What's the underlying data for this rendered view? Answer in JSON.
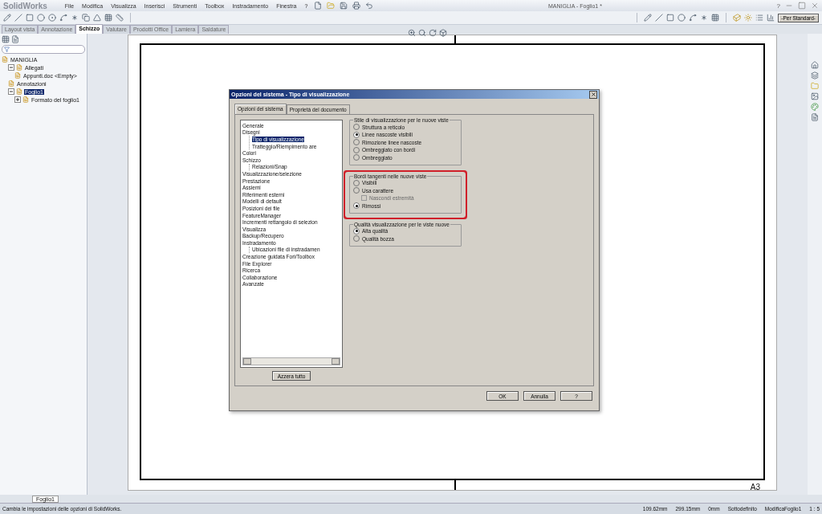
{
  "app": {
    "logo": "SolidWorks",
    "menus": [
      "File",
      "Modifica",
      "Visualizza",
      "Inserisci",
      "Strumenti",
      "Toolbox",
      "Instradamento",
      "Finestra",
      "?"
    ],
    "title": "MANIGLIA - Foglio1 *",
    "help": "?"
  },
  "command_tabs": [
    {
      "label": "Layout vista",
      "selected": false
    },
    {
      "label": "Annotazione",
      "selected": false
    },
    {
      "label": "Schizzo",
      "selected": true
    },
    {
      "label": "Valutare",
      "selected": false
    },
    {
      "label": "Prodotti Office",
      "selected": false
    },
    {
      "label": "Lamiera",
      "selected": false
    },
    {
      "label": "Saldature",
      "selected": false
    }
  ],
  "style_dropdown": {
    "value": "-Per Standard-"
  },
  "tree": {
    "items": [
      {
        "label": "MANIGLIA",
        "selected": false,
        "children": [
          {
            "label": "Allegati",
            "selected": false,
            "expanded": true,
            "children": [
              {
                "label": "Appunti.doc <Empty>",
                "selected": false
              }
            ]
          },
          {
            "label": "Annotazioni",
            "selected": false
          },
          {
            "label": "Foglio1",
            "selected": true,
            "expanded": true,
            "children": [
              {
                "label": "Formato del foglio1",
                "selected": false,
                "expanded": false
              }
            ]
          }
        ]
      }
    ]
  },
  "sheet": {
    "label": "A3"
  },
  "dialog": {
    "title": "Opzioni del sistema - Tipo di visualizzazione",
    "tabs": [
      {
        "label": "Opzioni del sistema",
        "selected": true
      },
      {
        "label": "Proprietà del documento",
        "selected": false
      }
    ],
    "options_tree": [
      {
        "label": "Generale",
        "selected": false
      },
      {
        "label": "Disegni",
        "selected": false,
        "children": [
          {
            "label": "Tipo di visualizzazione",
            "selected": true
          },
          {
            "label": "Tratteggio/Riempimento are",
            "selected": false
          }
        ]
      },
      {
        "label": "Colori",
        "selected": false
      },
      {
        "label": "Schizzo",
        "selected": false,
        "children": [
          {
            "label": "Relazioni/Snap",
            "selected": false
          }
        ]
      },
      {
        "label": "Visualizzazione/selezione",
        "selected": false
      },
      {
        "label": "Prestazione",
        "selected": false
      },
      {
        "label": "Assiemi",
        "selected": false
      },
      {
        "label": "Riferimenti esterni",
        "selected": false
      },
      {
        "label": "Modelli di default",
        "selected": false
      },
      {
        "label": "Posizioni dei file",
        "selected": false
      },
      {
        "label": "FeatureManager",
        "selected": false
      },
      {
        "label": "Incrementi rettangolo di selezion",
        "selected": false
      },
      {
        "label": "Visualizza",
        "selected": false
      },
      {
        "label": "Backup/Recupero",
        "selected": false
      },
      {
        "label": "Instradamento",
        "selected": false,
        "children": [
          {
            "label": "Ubicazioni file di instradamen",
            "selected": false
          }
        ]
      },
      {
        "label": "Creazione guidata Fori/Toolbox",
        "selected": false
      },
      {
        "label": "File Explorer",
        "selected": false
      },
      {
        "label": "Ricerca",
        "selected": false
      },
      {
        "label": "Collaborazione",
        "selected": false
      },
      {
        "label": "Avanzate",
        "selected": false
      }
    ],
    "reset_button": "Azzera tutto",
    "groups": [
      {
        "title": "Stile di visualizzazione per le nuove viste",
        "highlighted": false,
        "options": [
          {
            "kind": "radio",
            "label": "Struttura a reticolo",
            "checked": false
          },
          {
            "kind": "radio",
            "label": "Linee nascoste visibili",
            "checked": true
          },
          {
            "kind": "radio",
            "label": "Rimozione linee nascoste",
            "checked": false
          },
          {
            "kind": "radio",
            "label": "Ombreggiato con bordi",
            "checked": false
          },
          {
            "kind": "radio",
            "label": "Ombreggiato",
            "checked": false
          }
        ]
      },
      {
        "title": "Bordi tangenti nelle nuove viste",
        "highlighted": true,
        "options": [
          {
            "kind": "radio",
            "label": "Visibili",
            "checked": false
          },
          {
            "kind": "radio",
            "label": "Usa carattere",
            "checked": false
          },
          {
            "kind": "checkbox",
            "label": "Nascondi estremità",
            "checked": false,
            "disabled": true
          },
          {
            "kind": "radio",
            "label": "Rimossi",
            "checked": true
          }
        ]
      },
      {
        "title": "Qualità visualizzazione per le viste nuove",
        "highlighted": false,
        "options": [
          {
            "kind": "radio",
            "label": "Alta qualità",
            "checked": true
          },
          {
            "kind": "radio",
            "label": "Qualità bozza",
            "checked": false
          }
        ]
      }
    ],
    "footer_buttons": [
      "OK",
      "Annulla",
      "?"
    ]
  },
  "sheet_tabs": [
    {
      "label": "Foglio1",
      "selected": true
    }
  ],
  "status_bar": {
    "message": "Cambia le impostazioni delle opzioni di SolidWorks.",
    "fields": [
      "109.62mm",
      "299.15mm",
      "0mm",
      "Sottodefinito",
      "ModificaFoglio1",
      "1 : 5"
    ]
  }
}
